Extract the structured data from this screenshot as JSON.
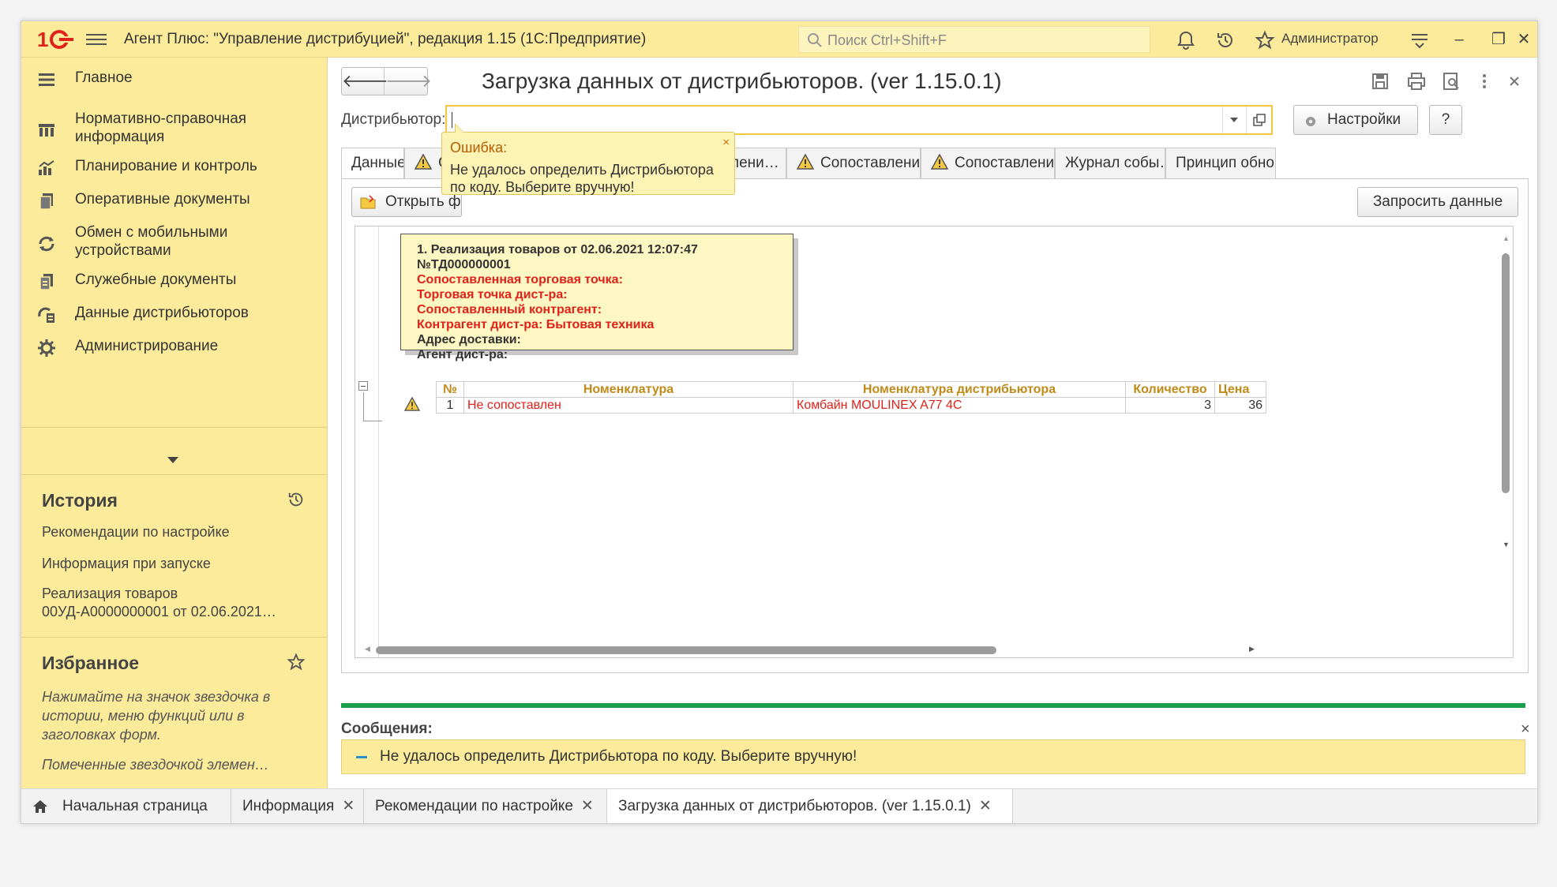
{
  "titlebar": {
    "app_title": "Агент Плюс: \"Управление дистрибуцией\", редакция 1.15  (1С:Предприятие)",
    "search_placeholder": "Поиск Ctrl+Shift+F",
    "username": "Администратор"
  },
  "sidebar": {
    "items": [
      {
        "label": "Главное",
        "icon": "menu-lines-icon"
      },
      {
        "label": "Нормативно-справочная информация",
        "icon": "reference-books-icon"
      },
      {
        "label": "Планирование и контроль",
        "icon": "bar-chart-icon"
      },
      {
        "label": "Оперативные документы",
        "icon": "documents-icon"
      },
      {
        "label": "Обмен с мобильными устройствами",
        "icon": "sync-icon"
      },
      {
        "label": "Служебные документы",
        "icon": "service-docs-icon"
      },
      {
        "label": "Данные дистрибьюторов",
        "icon": "distributor-data-icon"
      },
      {
        "label": "Администрирование",
        "icon": "gear-icon"
      }
    ],
    "history": {
      "title": "История",
      "items": [
        "Рекомендации по настройке",
        "Информация при запуске",
        "Реализация товаров",
        "00УД-А0000000001 от 02.06.2021…"
      ]
    },
    "favorites": {
      "title": "Избранное",
      "hint": "Нажимайте на значок звездочка в истории, меню функций или в заголовках форм.",
      "hint2": "Помеченные звездочкой элемен…"
    }
  },
  "form": {
    "title": "Загрузка данных от дистрибьюторов. (ver 1.15.0.1)",
    "distributor_label": "Дистрибьютор:",
    "distributor_value": "",
    "settings_button": "Настройки",
    "help_button": "?",
    "tabs": [
      {
        "label": "Данные",
        "warn": false
      },
      {
        "label": "Со",
        "warn": true
      },
      {
        "label": "лени…",
        "warn": false
      },
      {
        "label": "Сопоставлени…",
        "warn": true
      },
      {
        "label": "Сопоставлени…",
        "warn": true
      },
      {
        "label": "Журнал собы…",
        "warn": false
      },
      {
        "label": "Принцип обно…",
        "warn": false
      }
    ],
    "open_file_button": "Открыть фа",
    "request_data_button": "Запросить данные"
  },
  "error_popup": {
    "title": "Ошибка:",
    "text": "Не удалось определить Дистрибьютора по коду. Выберите вручную!",
    "close": "×"
  },
  "document_tooltip": {
    "header": "1. Реализация товаров от 02.06.2021 12:07:47 №ТД000000001",
    "matched_outlet": "Сопоставленная торговая точка:",
    "dist_outlet": "Торговая точка дист-ра:",
    "matched_counterparty": "Сопоставленный контрагент:",
    "dist_counterparty": "Контрагент дист-ра: Бытовая техника",
    "delivery_address": "Адрес доставки:",
    "dist_agent": "Агент дист-ра:"
  },
  "table": {
    "columns": [
      "№",
      "Номенклатура",
      "Номенклатура дистрибьютора",
      "Количество",
      "Цена"
    ],
    "rows": [
      {
        "num": "1",
        "item": "Не сопоставлен",
        "dist_item": "Комбайн MOULINEX  A77 4C",
        "qty": "3",
        "price": "36"
      }
    ]
  },
  "messages": {
    "title": "Сообщения:",
    "items": [
      "Не удалось определить Дистрибьютора по коду. Выберите вручную!"
    ]
  },
  "bottom_tabs": [
    {
      "label": "Начальная страница",
      "closable": false
    },
    {
      "label": "Информация",
      "closable": true
    },
    {
      "label": "Рекомендации по настройке",
      "closable": true
    },
    {
      "label": "Загрузка данных от дистрибьюторов. (ver 1.15.0.1)",
      "closable": true
    }
  ],
  "colors": {
    "accent_yellow": "#fbeb9a",
    "error_red": "#e0211a",
    "message_green": "#1a9f4a",
    "logo_red": "#e0211a"
  }
}
